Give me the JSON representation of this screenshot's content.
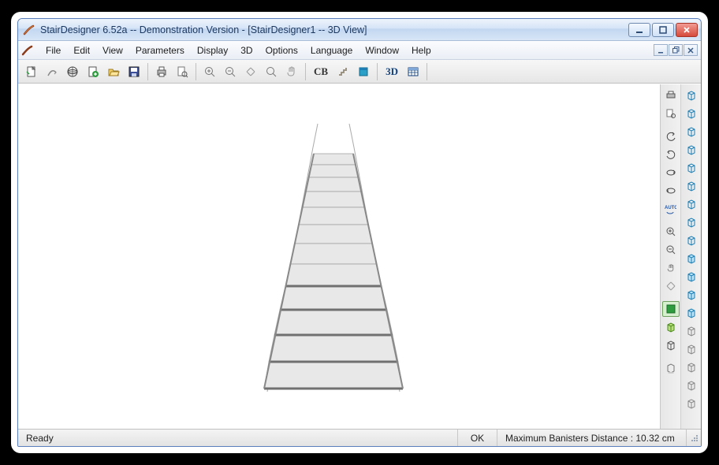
{
  "title": "StairDesigner 6.52a -- Demonstration Version - [StairDesigner1 -- 3D View]",
  "menu": {
    "items": [
      "File",
      "Edit",
      "View",
      "Parameters",
      "Display",
      "3D",
      "Options",
      "Language",
      "Window",
      "Help"
    ]
  },
  "toolbar": {
    "labels": {
      "cb": "CB",
      "threeD": "3D"
    },
    "icons": [
      "new-doc",
      "curve-arrow",
      "globe",
      "page-add",
      "open-folder",
      "save",
      "sep",
      "print",
      "print-preview",
      "sep",
      "zoom-in",
      "zoom-out",
      "zoom-fit",
      "zoom",
      "pan-hand",
      "sep",
      "cb-text",
      "stair-step",
      "panel-blue",
      "sep",
      "3d-text",
      "table"
    ]
  },
  "sidebars": {
    "left": [
      "print",
      "print-preview",
      "sep",
      "rotate-left",
      "rotate-right",
      "rotate-up",
      "rotate-down",
      "auto-rotate",
      "sep",
      "zoom-in",
      "zoom-out",
      "pan-hand",
      "extents",
      "sep",
      "solid-view",
      "wire-view",
      "box-view",
      "sep",
      "box-shadow"
    ],
    "right": [
      "cube",
      "cube",
      "cube",
      "cube",
      "cube",
      "cube",
      "cube",
      "cube",
      "cube",
      "cube-highlight",
      "cube-highlight",
      "cube-highlight",
      "cube-highlight",
      "cube",
      "cube",
      "cube",
      "cube",
      "cube"
    ]
  },
  "status": {
    "ready": "Ready",
    "ok": "OK",
    "info": "Maximum Banisters Distance : 10.32 cm"
  },
  "colors": {
    "accentBlue": "#1b7fb5",
    "accentGreen": "#2e9c3f",
    "closeRed": "#d54a3b"
  }
}
